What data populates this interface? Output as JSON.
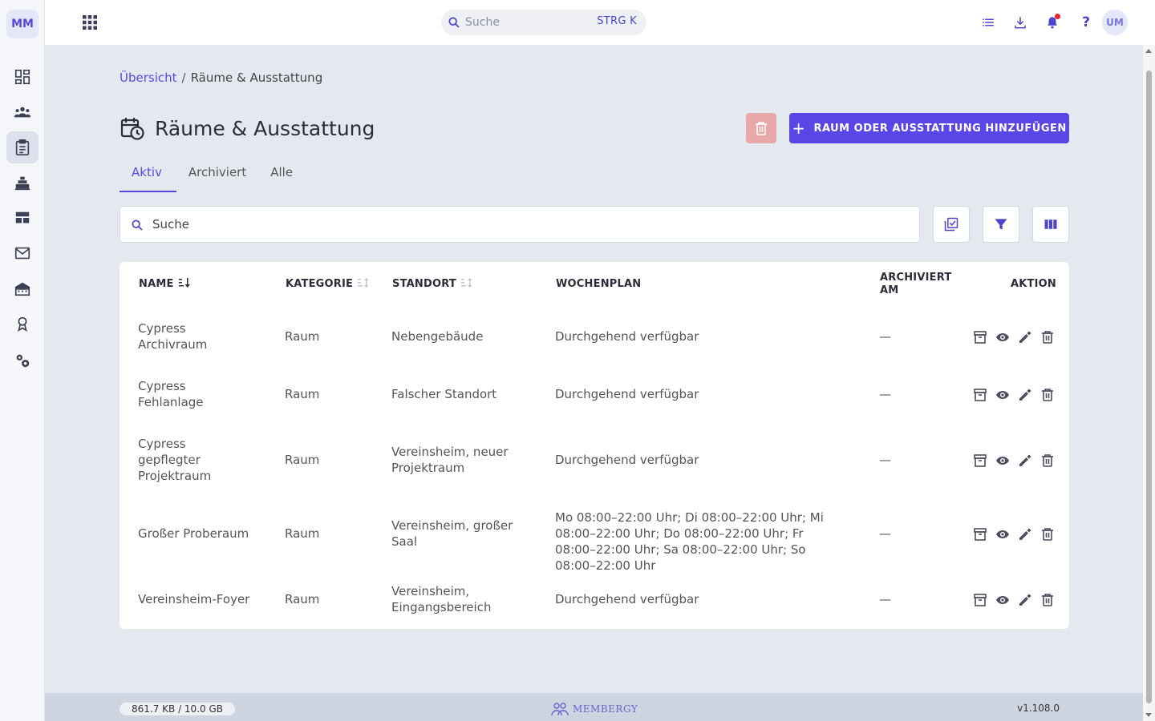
{
  "app": {
    "logo": "MM",
    "search": {
      "placeholder": "Suche",
      "shortcut": "STRG K"
    },
    "help": "?",
    "avatar": "UM"
  },
  "sidebar": {
    "items": [
      {
        "icon": "dashboard-icon",
        "active": false
      },
      {
        "icon": "members-icon",
        "active": false
      },
      {
        "icon": "clipboard-icon",
        "active": true
      },
      {
        "icon": "equipment-icon",
        "active": false
      },
      {
        "icon": "table-icon",
        "active": false
      },
      {
        "icon": "mail-icon",
        "active": false
      },
      {
        "icon": "building-icon",
        "active": false
      },
      {
        "icon": "award-icon",
        "active": false
      },
      {
        "icon": "settings-icon",
        "active": false
      }
    ]
  },
  "breadcrumb": {
    "link": "Übersicht",
    "separator": "/",
    "current": "Räume & Ausstattung"
  },
  "page": {
    "title": "Räume & Ausstattung",
    "add_button": "RAUM ODER AUSSTATTUNG HINZUFÜGEN",
    "add_icon": "+"
  },
  "tabs": [
    {
      "label": "Aktiv",
      "active": true
    },
    {
      "label": "Archiviert",
      "active": false
    },
    {
      "label": "Alle",
      "active": false
    }
  ],
  "filter": {
    "placeholder": "Suche"
  },
  "table": {
    "headers": {
      "name": "NAME",
      "category": "KATEGORIE",
      "location": "STANDORT",
      "schedule": "WOCHENPLAN",
      "archived": "ARCHIVIERT AM",
      "action": "AKTION"
    },
    "rows": [
      {
        "name": "Cypress Archivraum",
        "category": "Raum",
        "location": "Nebengebäude",
        "schedule": "Durchgehend verfügbar",
        "archived": "—"
      },
      {
        "name": "Cypress Fehlanlage",
        "category": "Raum",
        "location": "Falscher Standort",
        "schedule": "Durchgehend verfügbar",
        "archived": "—"
      },
      {
        "name": "Cypress gepflegter Projektraum",
        "category": "Raum",
        "location": "Vereinsheim, neuer Projektraum",
        "schedule": "Durchgehend verfügbar",
        "archived": "—"
      },
      {
        "name": "Großer Proberaum",
        "category": "Raum",
        "location": "Vereinsheim, großer Saal",
        "schedule": "Mo 08:00–22:00 Uhr; Di 08:00–22:00 Uhr; Mi 08:00–22:00 Uhr; Do 08:00–22:00 Uhr; Fr 08:00–22:00 Uhr; Sa 08:00–22:00 Uhr; So 08:00–22:00 Uhr",
        "archived": "—"
      },
      {
        "name": "Vereinsheim-Foyer",
        "category": "Raum",
        "location": "Vereinsheim, Eingangsbereich",
        "schedule": "Durchgehend verfügbar",
        "archived": "—"
      }
    ]
  },
  "footer": {
    "storage": "861.7 KB / 10.0 GB",
    "brand": "MEMBERGY",
    "version": "v1.108.0"
  },
  "colors": {
    "accent": "#5a45e6",
    "link": "#5848e0",
    "danger_disabled": "#e8a8a8",
    "notification": "#e5262f"
  }
}
